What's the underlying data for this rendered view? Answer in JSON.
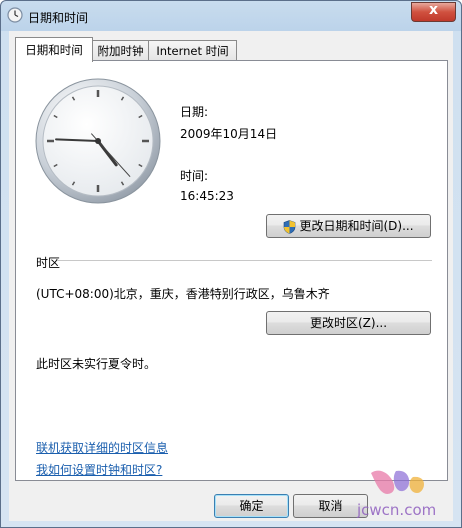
{
  "window": {
    "title": "日期和时间",
    "close_glyph": "x"
  },
  "tabs": [
    {
      "label": "日期和时间",
      "active": true
    },
    {
      "label": "附加时钟",
      "active": false
    },
    {
      "label": "Internet 时间",
      "active": false
    }
  ],
  "clock": {
    "hours": 16,
    "minutes": 45,
    "seconds": 23
  },
  "date": {
    "label": "日期:",
    "value": "2009年10月14日"
  },
  "time": {
    "label": "时间:",
    "value": "16:45:23"
  },
  "buttons": {
    "change_datetime": "更改日期和时间(D)...",
    "change_timezone": "更改时区(Z)...",
    "ok": "确定",
    "cancel": "取消"
  },
  "timezone": {
    "heading": "时区",
    "value": "(UTC+08:00)北京，重庆，香港特别行政区，乌鲁木齐",
    "dst_note": "此时区未实行夏令时。"
  },
  "links": {
    "online_info": "联机获取详细的时区信息",
    "how_to": "我如何设置时钟和时区?"
  },
  "watermark": {
    "text": "jcwcn.com"
  },
  "colors": {
    "link": "#1b5fae",
    "close_button": "#c0392b",
    "title_bar": "#bcd3ea"
  }
}
